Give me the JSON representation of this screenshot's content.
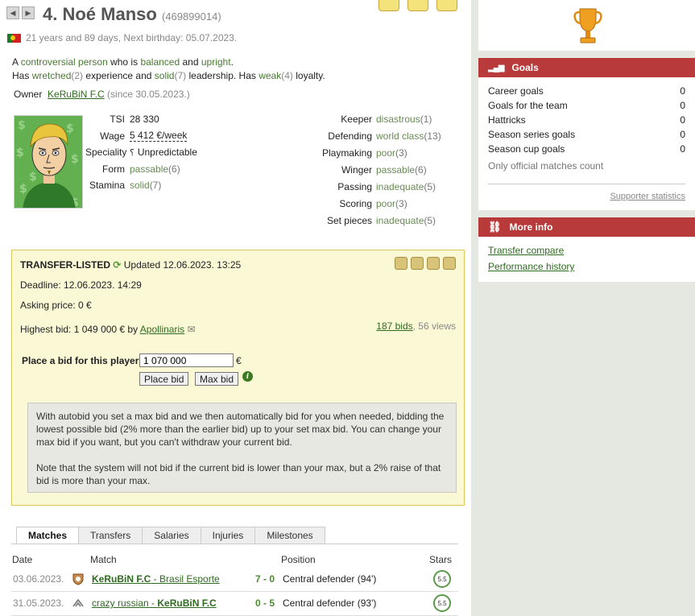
{
  "player": {
    "title": "4. Noé Manso",
    "id": "(469899014)",
    "age_line": "21 years and 89 days, Next birthday: 05.07.2023."
  },
  "description": {
    "l1_a": "A ",
    "l1_b": "controversial person",
    "l1_c": " who is ",
    "l1_d": "balanced",
    "l1_e": " and ",
    "l1_f": "upright",
    "l1_g": ".",
    "l2_a": "Has ",
    "l2_b": "wretched",
    "l2_c": "(2)",
    "l2_d": " experience and ",
    "l2_e": "solid",
    "l2_f": "(7)",
    "l2_g": " leadership. Has ",
    "l2_h": "weak",
    "l2_i": "(4)",
    "l2_j": " loyalty."
  },
  "owner": {
    "label": "Owner",
    "team": "KeRuBiN F.C",
    "since": "(since 30.05.2023.)"
  },
  "skills_left": [
    {
      "label": "TSI",
      "value": "28 330"
    },
    {
      "label": "Wage",
      "value": "5 412 €/week"
    },
    {
      "label": "Speciality",
      "icon": "unpredictable-icon",
      "value": "Unpredictable"
    },
    {
      "label": "Form",
      "value": "passable",
      "num": "(6)"
    },
    {
      "label": "Stamina",
      "value": "solid",
      "num": "(7)"
    }
  ],
  "skills_right": [
    {
      "label": "Keeper",
      "value": "disastrous",
      "num": "(1)"
    },
    {
      "label": "Defending",
      "value": "world class",
      "num": "(13)"
    },
    {
      "label": "Playmaking",
      "value": "poor",
      "num": "(3)"
    },
    {
      "label": "Winger",
      "value": "passable",
      "num": "(6)"
    },
    {
      "label": "Passing",
      "value": "inadequate",
      "num": "(5)"
    },
    {
      "label": "Scoring",
      "value": "poor",
      "num": "(3)"
    },
    {
      "label": "Set pieces",
      "value": "inadequate",
      "num": "(5)"
    }
  ],
  "transfer": {
    "status": "TRANSFER-LISTED",
    "updated": "Updated 12.06.2023. 13:25",
    "deadline": "Deadline: 12.06.2023. 14:29",
    "asking": "Asking price: 0 €",
    "highest_prefix": "Highest bid: 1 049 000 € by ",
    "highest_by": "Apollinaris",
    "bids_link": "187 bids",
    "views": ", 56 views",
    "place_label": "Place a bid for this player",
    "bid_value": "1 070 000",
    "currency": "€",
    "place_btn": "Place bid",
    "max_btn": "Max bid",
    "autobid_p1": "With autobid you set a max bid and we then automatically bid for you when needed, bidding the lowest possible bid (2% more than the earlier bid) up to your set max bid. You can change your max bid if you want, but you can't withdraw your current bid.",
    "autobid_p2": "Note that the system will not bid if the current bid is lower than your max, but a 2% raise of that bid is more than your max."
  },
  "tabs": [
    "Matches",
    "Transfers",
    "Salaries",
    "Injuries",
    "Milestones"
  ],
  "matches": {
    "headers": {
      "date": "Date",
      "match": "Match",
      "position": "Position",
      "stars": "Stars"
    },
    "rows": [
      {
        "date": "03.06.2023.",
        "home": "KeRuBiN F.C",
        "sep": " - ",
        "away": "Brasil Esporte",
        "score": "7 - 0",
        "position": "Central defender (94')",
        "stars": "5.5"
      },
      {
        "date": "31.05.2023.",
        "home": "crazy russian",
        "sep": " - ",
        "away": "KeRuBiN F.C",
        "score": "0 - 5",
        "position": "Central defender (93')",
        "stars": "5.5"
      }
    ]
  },
  "goals": {
    "title": "Goals",
    "rows": [
      {
        "label": "Career goals",
        "value": "0"
      },
      {
        "label": "Goals for the team",
        "value": "0"
      },
      {
        "label": "Hattricks",
        "value": "0"
      },
      {
        "label": "Season series goals",
        "value": "0"
      },
      {
        "label": "Season cup goals",
        "value": "0"
      }
    ],
    "note": "Only official matches count",
    "supporter_link": "Supporter statistics"
  },
  "more_info": {
    "title": "More info",
    "links": [
      "Transfer compare",
      "Performance history"
    ]
  },
  "colors": {
    "panel_header": "#b83a3a",
    "transfer_bg": "#fbf8d6",
    "link": "#2e6b1f",
    "skill_level": "#6a8a55"
  }
}
